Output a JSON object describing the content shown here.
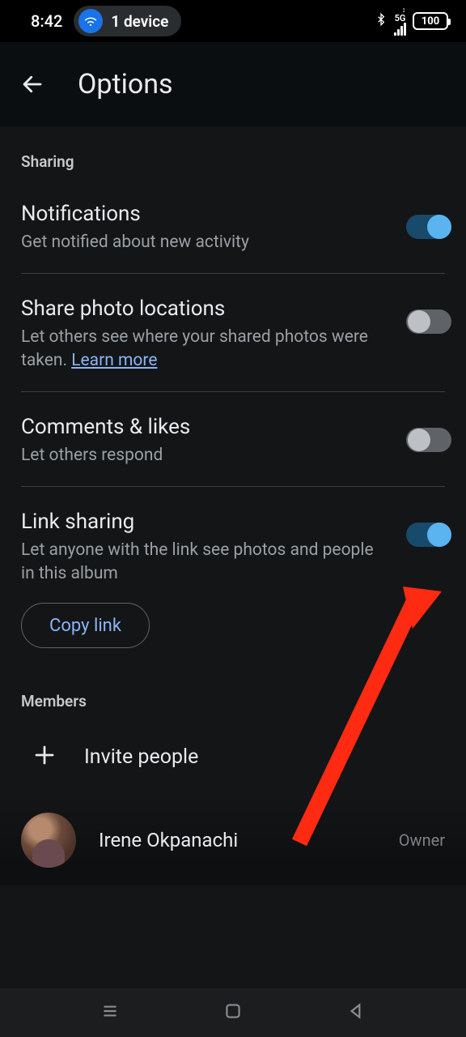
{
  "status": {
    "time": "8:42",
    "device_count_label": "1 device",
    "network_type": "5G",
    "battery_pct": "100"
  },
  "appbar": {
    "title": "Options"
  },
  "sections": {
    "sharing_label": "Sharing",
    "members_label": "Members"
  },
  "settings": {
    "notifications": {
      "title": "Notifications",
      "desc": "Get notified about new activity",
      "on": true
    },
    "locations": {
      "title": "Share photo locations",
      "desc_prefix": "Let others see where your shared photos were taken. ",
      "learn_more": "Learn more",
      "on": false
    },
    "comments": {
      "title": "Comments & likes",
      "desc": "Let others respond",
      "on": false
    },
    "link_sharing": {
      "title": "Link sharing",
      "desc": "Let anyone with the link see photos and people in this album",
      "on": true,
      "copy_label": "Copy link"
    }
  },
  "invite": {
    "label": "Invite people"
  },
  "members": [
    {
      "name": "Irene Okpanachi",
      "role": "Owner"
    }
  ],
  "annotation": {
    "arrow_target": "link-sharing-toggle",
    "color": "#ff2a12"
  }
}
